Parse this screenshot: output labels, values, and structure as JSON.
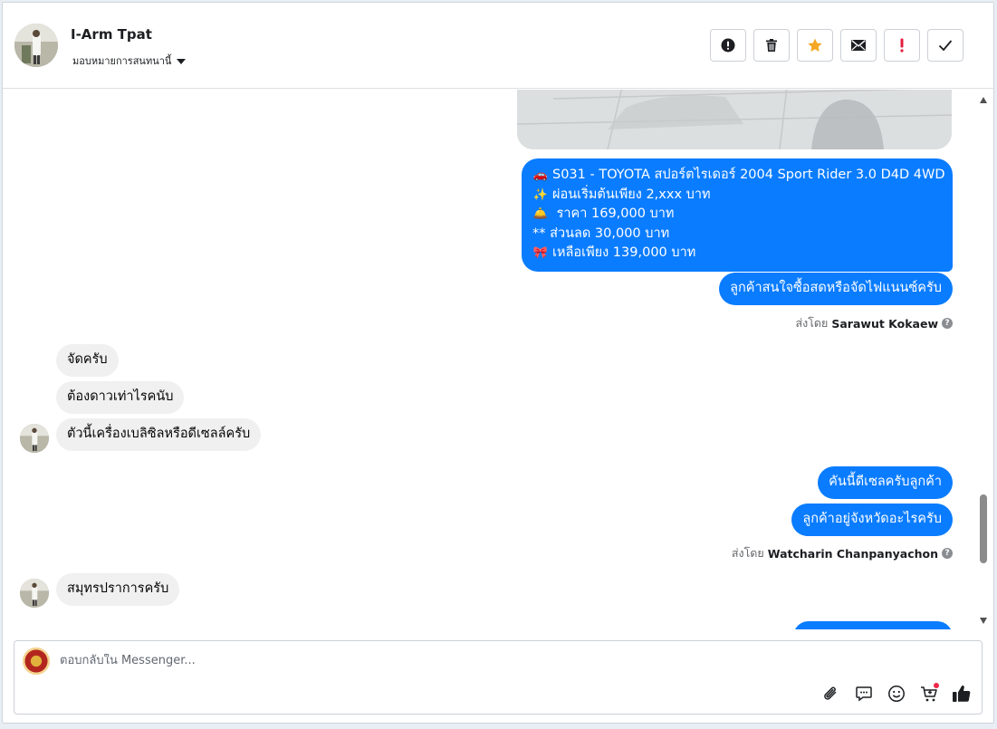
{
  "header": {
    "contact_name": "I-Arm Tpat",
    "assign_label": "มอบหมายการสนทนานี้",
    "actions": [
      {
        "name": "report-spam-button",
        "icon": "exclamation-circle-icon"
      },
      {
        "name": "delete-button",
        "icon": "trash-icon"
      },
      {
        "name": "star-button",
        "icon": "star-icon"
      },
      {
        "name": "mark-unread-button",
        "icon": "envelope-icon"
      },
      {
        "name": "follow-up-button",
        "icon": "exclamation-icon"
      },
      {
        "name": "mark-done-button",
        "icon": "check-icon"
      }
    ]
  },
  "messages": {
    "offer_lines": [
      {
        "emoji": "🚗",
        "text": "S031 - TOYOTA สปอร์ตไรเดอร์ 2004 Sport Rider 3.0 D4D 4WD"
      },
      {
        "emoji": "✨",
        "text": "ผ่อนเริ่มต้นเพียง 2,xxx บาท"
      },
      {
        "emoji": "🛎️",
        "text": " ราคา 169,000 บาท"
      },
      {
        "emoji": "",
        "text": "** ส่วนลด 30,000 บาท"
      },
      {
        "emoji": "🎀",
        "text": "เหลือเพียง 139,000 บาท"
      }
    ],
    "out_ask_payment": "ลูกค้าสนใจซื้อสดหรือจัดไฟแนนซ์ครับ",
    "sent_by_1_prefix": "ส่งโดย",
    "sent_by_1_name": "Sarawut Kokaew",
    "in_1": "จัดครับ",
    "in_2": "ต้องดาวเท่าไรคนับ",
    "in_3": "ตัวนี้เครื่องเบลิซิลหรือดีเซลล์ครับ",
    "out_diesel": "คันนี้ดีเซลครับลูกค้า",
    "out_province": "ลูกค้าอยู่จังหวัดอะไรครับ",
    "sent_by_2_prefix": "ส่งโดย",
    "sent_by_2_name": "Watcharin Chanpanyachon",
    "in_4": "สมุทรปราการครับ"
  },
  "composer": {
    "placeholder": "ตอบกลับใน Messenger...",
    "tools": [
      "attachment-icon",
      "saved-reply-icon",
      "emoji-icon",
      "add-to-cart-icon",
      "like-icon"
    ]
  },
  "colors": {
    "outgoing_bubble": "#0a7cff",
    "incoming_bubble": "#f0f0f0",
    "star_active": "#f5a623",
    "follow_up_red": "#e41e3f"
  }
}
